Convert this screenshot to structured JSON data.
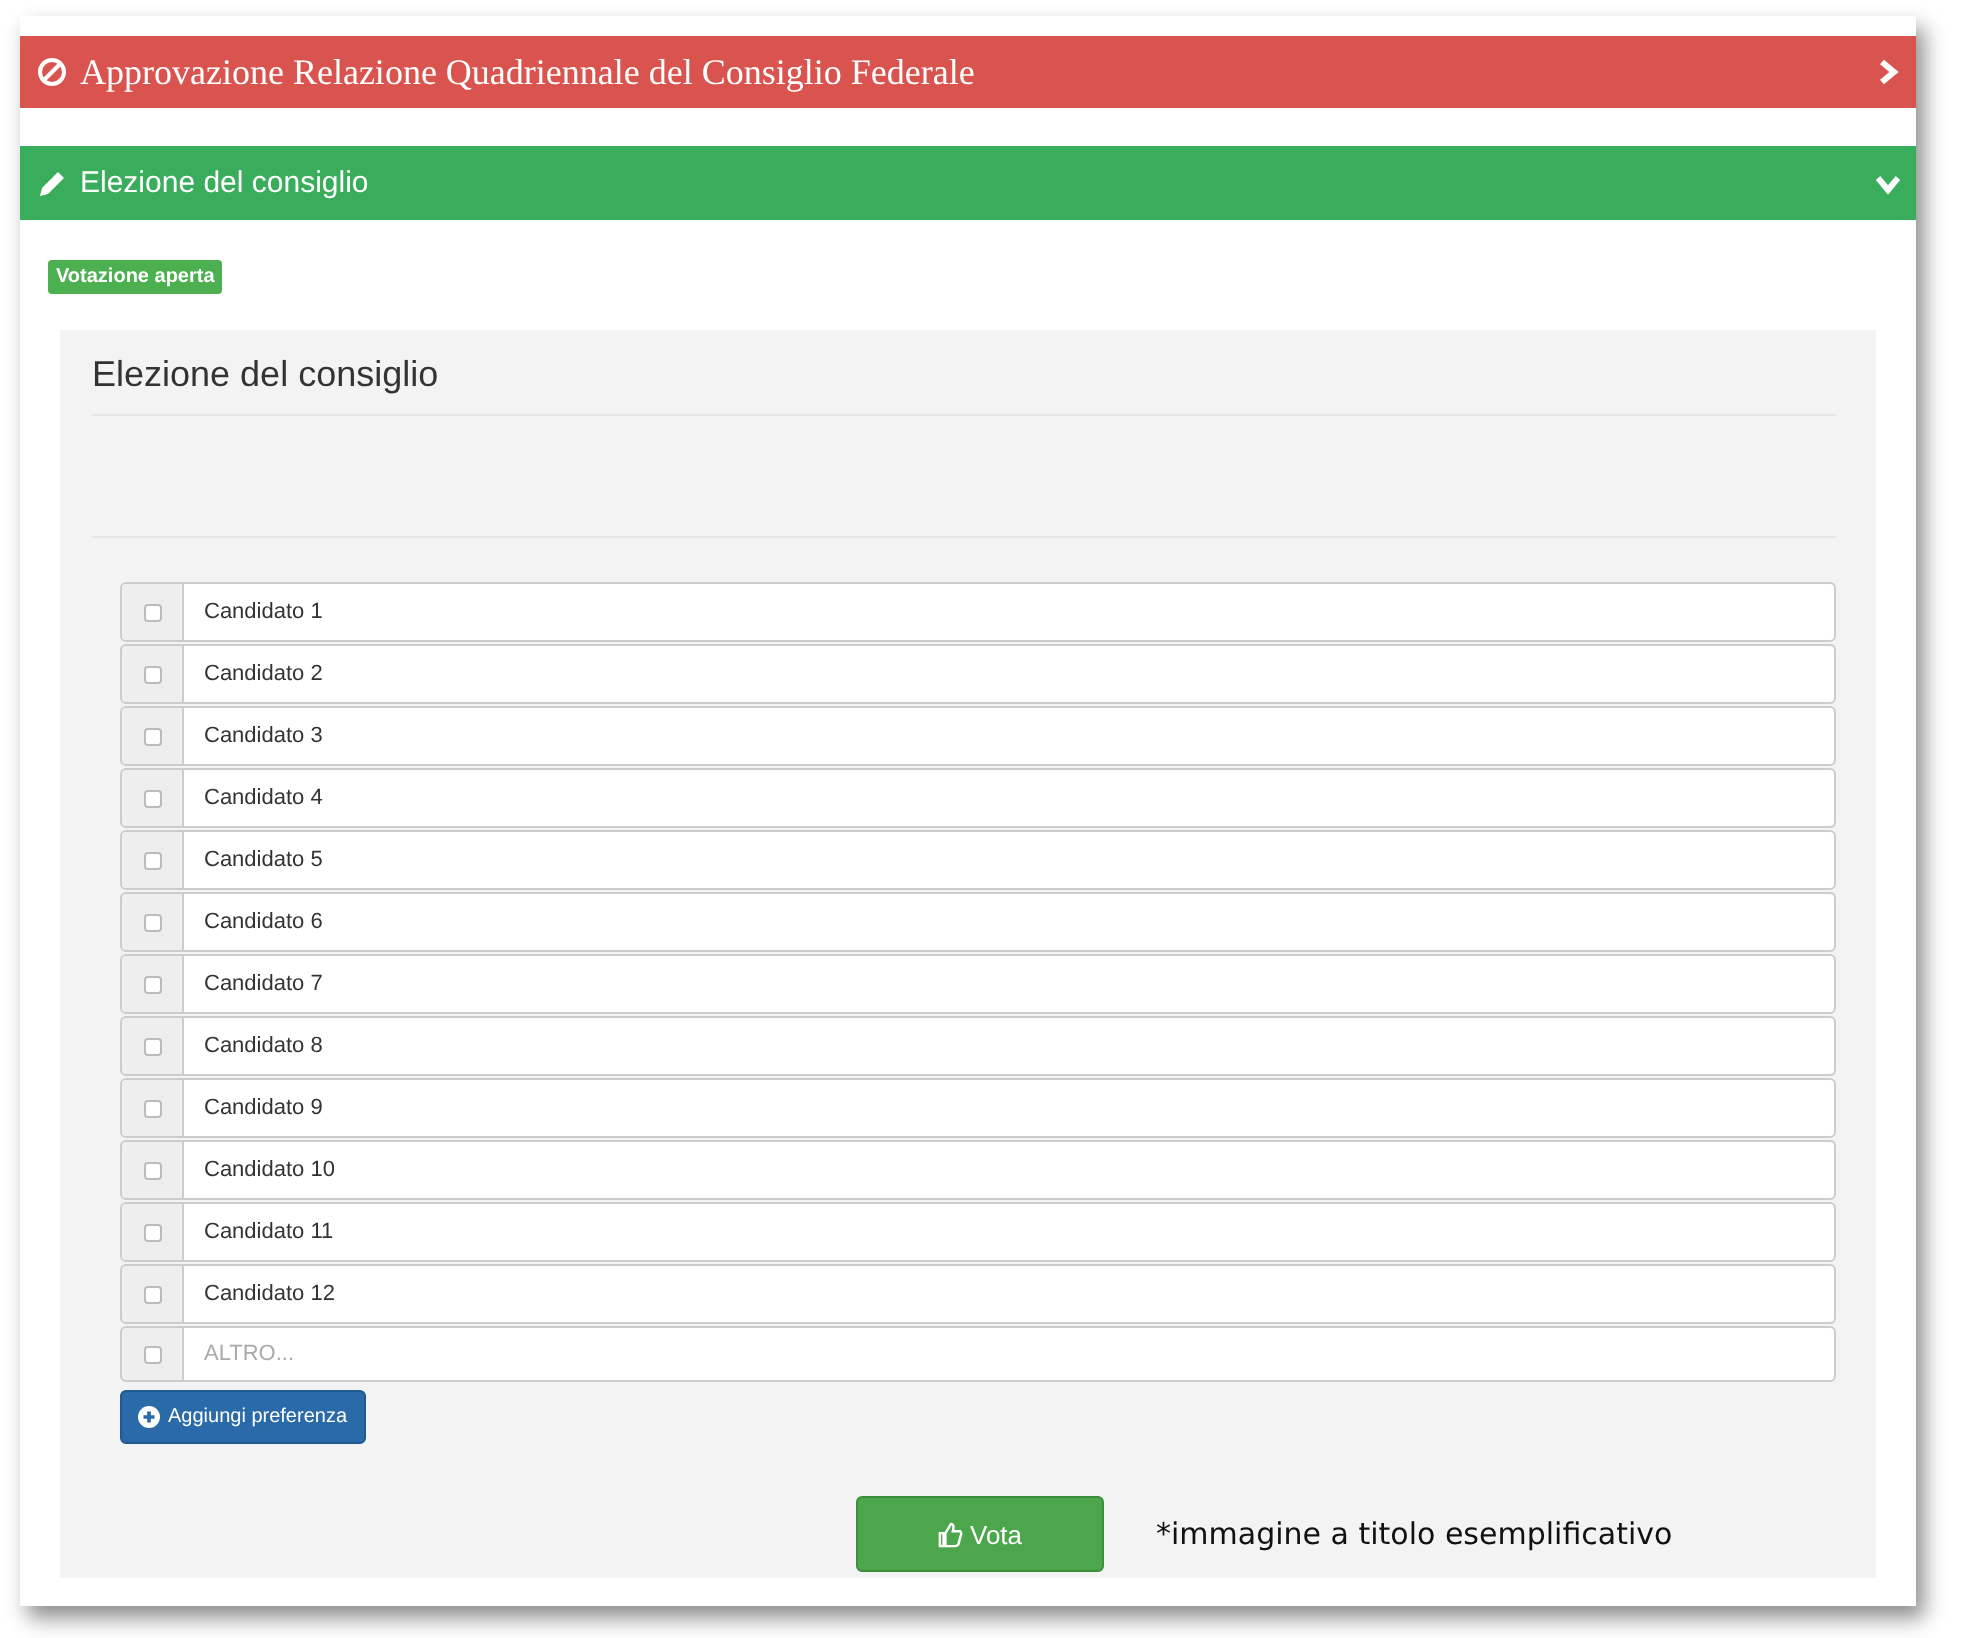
{
  "sections": [
    {
      "kind": "closed",
      "title": "Approvazione Relazione Quadriennale del Consiglio Federale",
      "expanded": false
    },
    {
      "kind": "open",
      "title": "Elezione del consiglio",
      "expanded": true
    }
  ],
  "badge": "Votazione aperta",
  "panel": {
    "title": "Elezione del consiglio",
    "candidates": [
      {
        "label": "Candidato 1",
        "checked": false
      },
      {
        "label": "Candidato 2",
        "checked": false
      },
      {
        "label": "Candidato 3",
        "checked": false
      },
      {
        "label": "Candidato 4",
        "checked": false
      },
      {
        "label": "Candidato 5",
        "checked": false
      },
      {
        "label": "Candidato 6",
        "checked": false
      },
      {
        "label": "Candidato 7",
        "checked": false
      },
      {
        "label": "Candidato 8",
        "checked": false
      },
      {
        "label": "Candidato 9",
        "checked": false
      },
      {
        "label": "Candidato 10",
        "checked": false
      },
      {
        "label": "Candidato 11",
        "checked": false
      },
      {
        "label": "Candidato 12",
        "checked": false
      }
    ],
    "other": {
      "placeholder": "ALTRO...",
      "checked": false
    },
    "add_button": "Aggiungi preferenza",
    "vote_button": "Vota"
  },
  "note": "*immagine a titolo esemplificativo"
}
